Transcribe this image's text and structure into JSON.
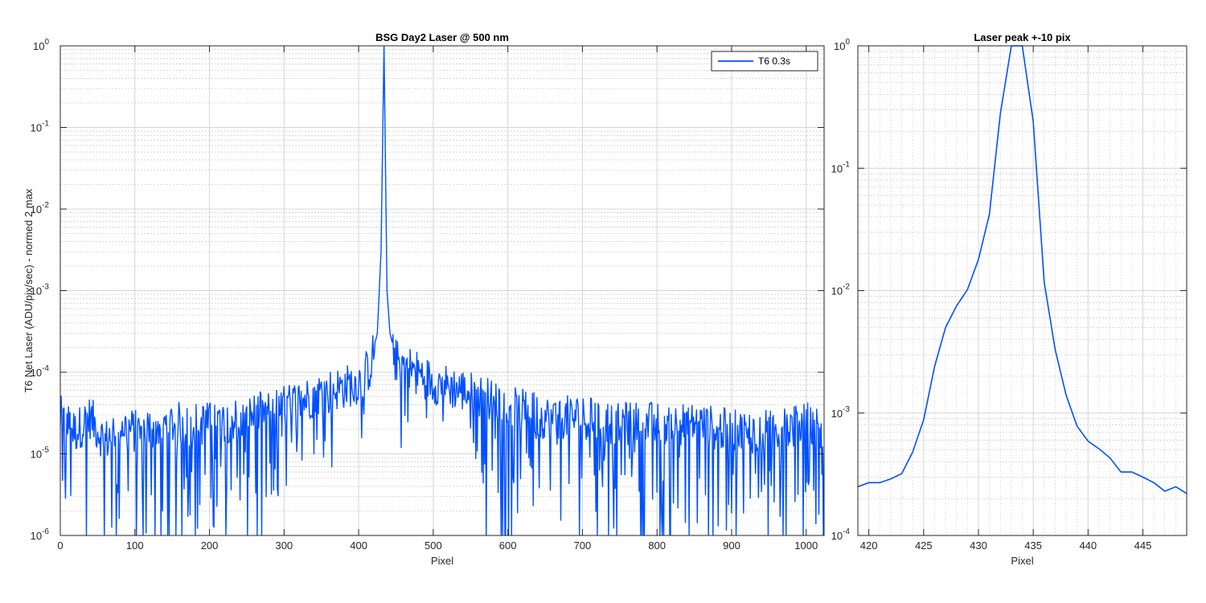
{
  "chart_data": [
    {
      "type": "line",
      "title": "BSG  Day2 Laser @ 500 nm",
      "xlabel": "Pixel",
      "ylabel": "T6 Net Laser (ADU/pix/sec) - normed 2 max",
      "xlim": [
        0,
        1024
      ],
      "ylim_log10": [
        -6,
        0
      ],
      "yscale": "log",
      "grid": "on (major + minor)",
      "legend_position": "top-right",
      "x_ticks": [
        "0",
        "100",
        "200",
        "300",
        "400",
        "500",
        "600",
        "700",
        "800",
        "900",
        "1000"
      ],
      "y_ticks": [
        {
          "base": "10",
          "exp": "-6"
        },
        {
          "base": "10",
          "exp": "-5"
        },
        {
          "base": "10",
          "exp": "-4"
        },
        {
          "base": "10",
          "exp": "-3"
        },
        {
          "base": "10",
          "exp": "-2"
        },
        {
          "base": "10",
          "exp": "-1"
        },
        {
          "base": "10",
          "exp": "0"
        }
      ],
      "series": [
        {
          "name": "T6 0.3s",
          "color": "#0050ff",
          "description": "noisy floor near 1e-5 to 5e-5 with dropouts below 1e-6; rises toward ~1e-4 near pixels 300-500; sharp laser peak at pixel ~434 reaching 1.0",
          "points": [
            [
              0,
              3e-05
            ],
            [
              20,
              2e-05
            ],
            [
              40,
              3e-05
            ],
            [
              60,
              1.5e-05
            ],
            [
              80,
              2.5e-05
            ],
            [
              100,
              2e-05
            ],
            [
              150,
              2.5e-05
            ],
            [
              200,
              2.5e-05
            ],
            [
              250,
              3e-05
            ],
            [
              300,
              4e-05
            ],
            [
              350,
              6e-05
            ],
            [
              380,
              7e-05
            ],
            [
              400,
              8e-05
            ],
            [
              415,
              0.00012
            ],
            [
              425,
              0.0003
            ],
            [
              430,
              0.003
            ],
            [
              434,
              1.0
            ],
            [
              438,
              0.001
            ],
            [
              442,
              0.0003
            ],
            [
              450,
              0.00015
            ],
            [
              470,
              0.00012
            ],
            [
              500,
              8e-05
            ],
            [
              550,
              6e-05
            ],
            [
              600,
              4e-05
            ],
            [
              650,
              3e-05
            ],
            [
              700,
              3e-05
            ],
            [
              750,
              2.5e-05
            ],
            [
              800,
              2.5e-05
            ],
            [
              850,
              2.5e-05
            ],
            [
              900,
              2e-05
            ],
            [
              950,
              2e-05
            ],
            [
              1000,
              2.5e-05
            ],
            [
              1024,
              2e-05
            ]
          ]
        }
      ]
    },
    {
      "type": "line",
      "title": "Laser peak +-10 pix",
      "xlabel": "Pixel",
      "xlim": [
        419,
        449
      ],
      "ylim_log10": [
        -4,
        0
      ],
      "yscale": "log",
      "grid": "on (major + minor)",
      "x_ticks": [
        "420",
        "425",
        "430",
        "435",
        "440",
        "445"
      ],
      "y_ticks": [
        {
          "base": "10",
          "exp": "-4"
        },
        {
          "base": "10",
          "exp": "-3"
        },
        {
          "base": "10",
          "exp": "-2"
        },
        {
          "base": "10",
          "exp": "-1"
        },
        {
          "base": "10",
          "exp": "0"
        }
      ],
      "series": [
        {
          "color": "#0050ff",
          "x": [
            419,
            420,
            421,
            422,
            423,
            424,
            425,
            426,
            427,
            428,
            429,
            430,
            431,
            432,
            433,
            434,
            435,
            436,
            437,
            438,
            439,
            440,
            441,
            442,
            443,
            444,
            445,
            446,
            447,
            448,
            449
          ],
          "y": [
            0.00025,
            0.00027,
            0.00027,
            0.00029,
            0.00032,
            0.00048,
            0.00088,
            0.0024,
            0.005,
            0.0075,
            0.0102,
            0.018,
            0.042,
            0.28,
            1.0,
            1.02,
            0.24,
            0.0117,
            0.0033,
            0.0014,
            0.00078,
            0.00059,
            0.00051,
            0.00043,
            0.00033,
            0.00033,
            0.0003,
            0.00027,
            0.00023,
            0.00025,
            0.00022
          ]
        }
      ]
    }
  ]
}
